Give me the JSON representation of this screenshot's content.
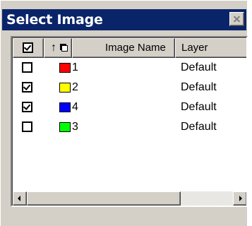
{
  "window": {
    "title": "Select Image",
    "close_icon": "close-icon"
  },
  "table": {
    "header": {
      "check_all": {
        "checked": true,
        "icon": "checkbox-checked-icon"
      },
      "sort": {
        "arrow": "↑",
        "icon": "sort-order-icon"
      },
      "name_label": "Image Name",
      "layer_label": "Layer"
    },
    "rows": [
      {
        "checked": false,
        "color": "#ff0000",
        "name": "1",
        "layer": "Default"
      },
      {
        "checked": true,
        "color": "#ffff00",
        "name": "2",
        "layer": "Default"
      },
      {
        "checked": true,
        "color": "#0000ff",
        "name": "4",
        "layer": "Default"
      },
      {
        "checked": false,
        "color": "#00ff00",
        "name": "3",
        "layer": "Default"
      }
    ]
  },
  "scrollbar": {
    "position": 0,
    "left_icon": "scroll-left-arrow-icon",
    "right_icon": "scroll-right-arrow-icon"
  }
}
